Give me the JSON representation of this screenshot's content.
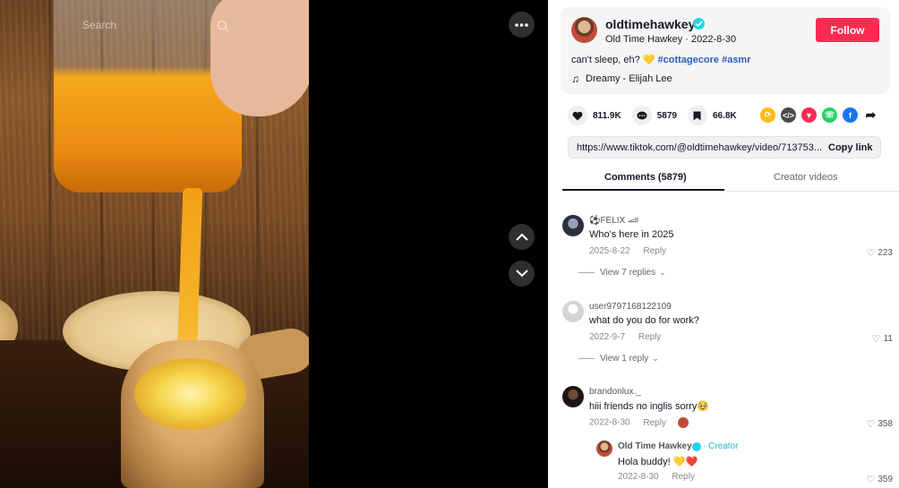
{
  "search": {
    "placeholder": "Search"
  },
  "author": {
    "username": "oldtimehawkey",
    "display_name": "Old Time Hawkey",
    "date": "2022-8-30",
    "follow_label": "Follow",
    "caption_text": "can't sleep, eh? 💛",
    "hashtags": [
      "#cottagecore",
      "#asmr"
    ],
    "music": "Dreamy - Elijah Lee"
  },
  "stats": {
    "likes": "811.9K",
    "comments": "5879",
    "saves": "66.8K"
  },
  "link": {
    "url": "https://www.tiktok.com/@oldtimehawkey/video/713753...",
    "copy_label": "Copy link"
  },
  "tabs": {
    "comments": "Comments (5879)",
    "creator": "Creator videos"
  },
  "comments": [
    {
      "name": "⚽FELIX 🏎",
      "text": "Who's here in 2025",
      "date": "2025-8-22",
      "reply": "Reply",
      "likes": "223",
      "view_replies": "View 7 replies"
    },
    {
      "name": "user9797168122109",
      "text": "what do you do for work?",
      "date": "2022-9-7",
      "reply": "Reply",
      "likes": "11",
      "view_replies": "View 1 reply"
    },
    {
      "name": "brandonlux._",
      "text": "hiii friends no inglis sorry🥹",
      "date": "2022-8-30",
      "reply": "Reply",
      "likes": "358"
    }
  ],
  "creator_reply": {
    "name": "Old Time Hawkey",
    "badge": "· Creator",
    "text": "Hola buddy! 💛❤️",
    "date": "2022-8-30",
    "reply": "Reply",
    "likes": "359"
  },
  "colors": {
    "follow": "#fe2c55",
    "hashtag": "#2b5db9",
    "verified": "#20d5ec"
  }
}
